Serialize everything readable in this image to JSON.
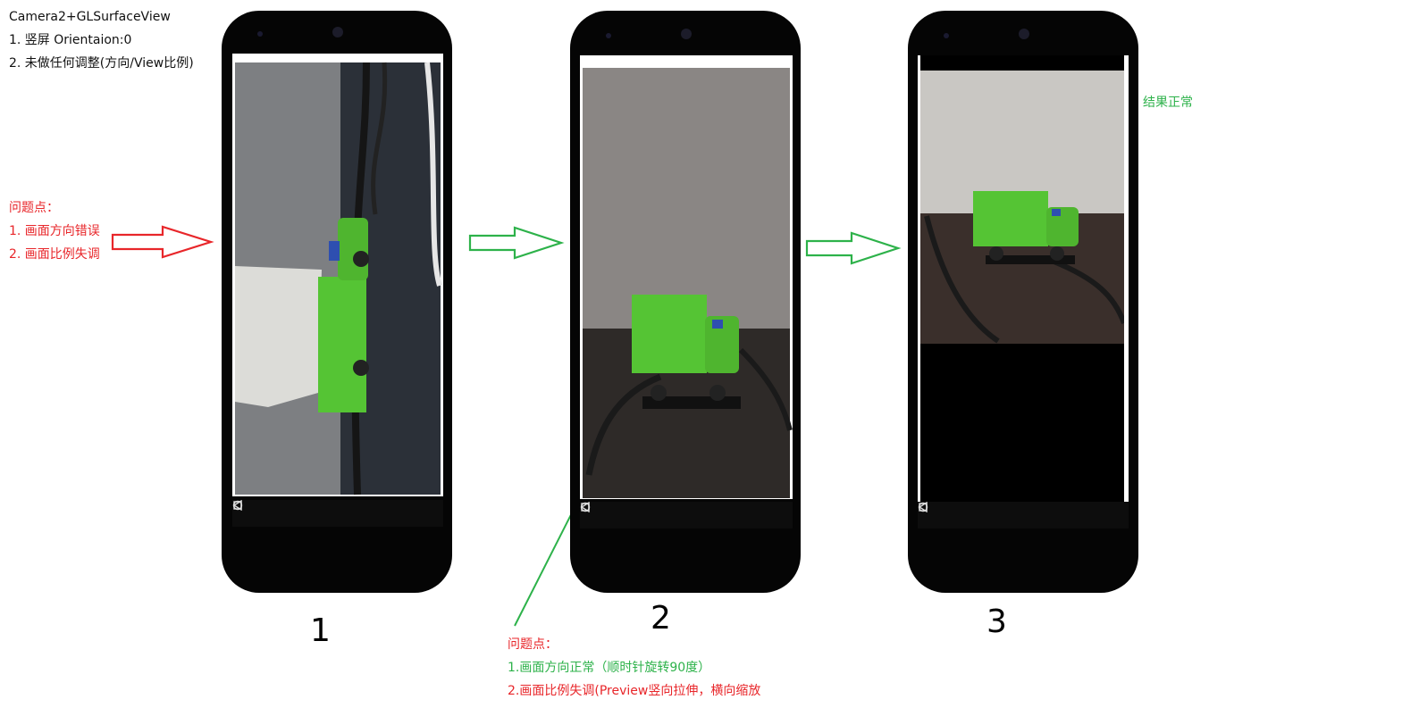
{
  "header": {
    "title": "Camera2+GLSurfaceView",
    "line1": "1. 竖屏 Orientaion:0",
    "line2": "2. 未做任何调整(方向/View比例)"
  },
  "issues_left": {
    "heading": "问题点：",
    "item1": "1. 画面方向错误",
    "item2": "2. 画面比例失调"
  },
  "result_right": {
    "text": "结果正常"
  },
  "issues_bottom": {
    "heading": "问题点：",
    "item1": "1.画面方向正常（顺时针旋转90度）",
    "item2": "2.画面比例失调(Preview竖向拉伸，横向缩放"
  },
  "phones": [
    {
      "number": "1"
    },
    {
      "number": "2"
    },
    {
      "number": "3"
    }
  ],
  "colors": {
    "red": "#e8262a",
    "green": "#2db24a",
    "phone_body": "#050505",
    "truck": "#55c434"
  },
  "icons": [
    "back-triangle-icon",
    "home-circle-icon",
    "recent-square-icon"
  ]
}
